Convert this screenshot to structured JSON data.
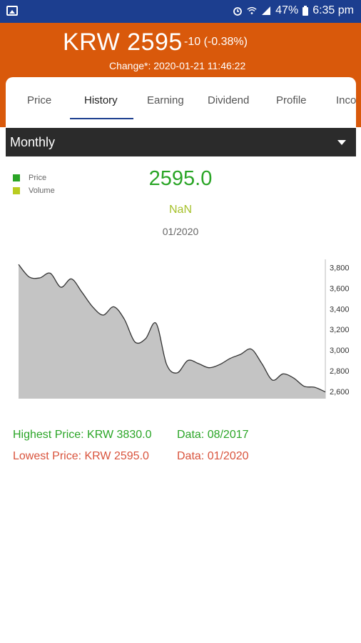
{
  "status_bar": {
    "battery": "47%",
    "time": "6:35 pm",
    "icons": [
      "image-icon",
      "alarm-icon",
      "wifi-icon",
      "signal-icon",
      "battery-icon"
    ]
  },
  "header": {
    "price": "KRW 2595",
    "change": "-10 (-0.38%)",
    "change_time": "Change*: 2020-01-21 11:46:22"
  },
  "tabs": [
    "Price",
    "History",
    "Earning",
    "Dividend",
    "Profile",
    "Inco"
  ],
  "active_tab": "History",
  "period": {
    "label": "Monthly"
  },
  "legend": [
    {
      "label": "Price",
      "color": "#2aa526"
    },
    {
      "label": "Volume",
      "color": "#b9cc20"
    }
  ],
  "selected": {
    "value": "2595.0",
    "volume": "NaN",
    "date": "01/2020"
  },
  "chart_data": {
    "type": "area",
    "ylim": [
      2530,
      3880
    ],
    "yticks": [
      "2,600",
      "2,800",
      "3,000",
      "3,200",
      "3,400",
      "3,600",
      "3,800"
    ],
    "ytick_values": [
      2600,
      2800,
      3000,
      3200,
      3400,
      3600,
      3800
    ],
    "values": [
      3830,
      3710,
      3700,
      3745,
      3610,
      3690,
      3560,
      3420,
      3340,
      3420,
      3300,
      3080,
      3110,
      3260,
      2860,
      2780,
      2900,
      2870,
      2830,
      2860,
      2920,
      2960,
      3010,
      2870,
      2710,
      2770,
      2730,
      2650,
      2640,
      2595
    ],
    "colors": {
      "fill": "#c4c4c4",
      "line": "#333333"
    }
  },
  "stats": {
    "highest": "Highest Price: KRW 3830.0",
    "highest_date": "Data: 08/2017",
    "lowest": "Lowest Price: KRW 2595.0",
    "lowest_date": "Data: 01/2020"
  }
}
